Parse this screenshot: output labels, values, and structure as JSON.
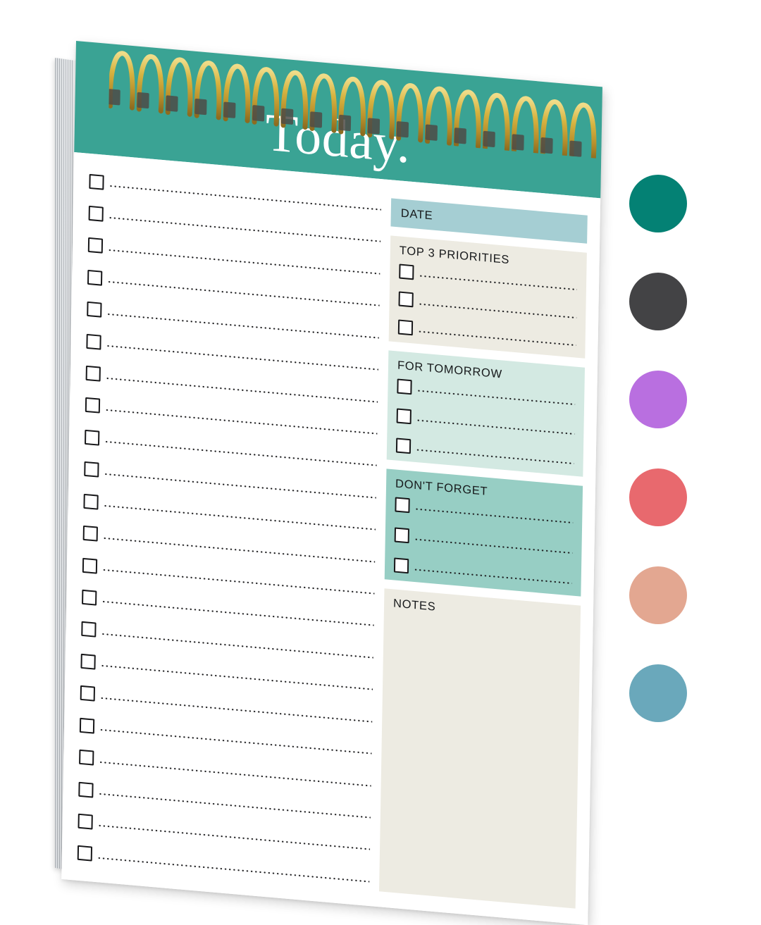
{
  "product": {
    "type": "spiral-bound daily to-do notepad",
    "header_title": "Today."
  },
  "notepad": {
    "header": {
      "title": "Today.",
      "background_color": "#3aa394",
      "title_color": "#ffffff"
    },
    "binding": {
      "style": "twin-loop wire spiral",
      "color": "#d4b23f",
      "loop_count": 17
    },
    "checklist": {
      "row_count": 22,
      "rows": [
        {
          "checkbox": "unchecked",
          "line": "dotted"
        },
        {
          "checkbox": "unchecked",
          "line": "dotted"
        },
        {
          "checkbox": "unchecked",
          "line": "dotted"
        },
        {
          "checkbox": "unchecked",
          "line": "dotted"
        },
        {
          "checkbox": "unchecked",
          "line": "dotted"
        },
        {
          "checkbox": "unchecked",
          "line": "dotted"
        },
        {
          "checkbox": "unchecked",
          "line": "dotted"
        },
        {
          "checkbox": "unchecked",
          "line": "dotted"
        },
        {
          "checkbox": "unchecked",
          "line": "dotted"
        },
        {
          "checkbox": "unchecked",
          "line": "dotted"
        },
        {
          "checkbox": "unchecked",
          "line": "dotted"
        },
        {
          "checkbox": "unchecked",
          "line": "dotted"
        },
        {
          "checkbox": "unchecked",
          "line": "dotted"
        },
        {
          "checkbox": "unchecked",
          "line": "dotted"
        },
        {
          "checkbox": "unchecked",
          "line": "dotted"
        },
        {
          "checkbox": "unchecked",
          "line": "dotted"
        },
        {
          "checkbox": "unchecked",
          "line": "dotted"
        },
        {
          "checkbox": "unchecked",
          "line": "dotted"
        },
        {
          "checkbox": "unchecked",
          "line": "dotted"
        },
        {
          "checkbox": "unchecked",
          "line": "dotted"
        },
        {
          "checkbox": "unchecked",
          "line": "dotted"
        },
        {
          "checkbox": "unchecked",
          "line": "dotted"
        }
      ]
    },
    "panels": [
      {
        "id": "date",
        "label": "DATE",
        "background_color": "#a5ced3",
        "rows": 0
      },
      {
        "id": "priorities",
        "label": "TOP 3 PRIORITIES",
        "background_color": "#edebe2",
        "rows": 3
      },
      {
        "id": "tomorrow",
        "label": "FOR TOMORROW",
        "background_color": "#d3e9e2",
        "rows": 3
      },
      {
        "id": "forget",
        "label": "DON'T FORGET",
        "background_color": "#97cec4",
        "rows": 3
      },
      {
        "id": "notes",
        "label": "NOTES",
        "background_color": "#edebe2",
        "rows": 0
      }
    ]
  },
  "swatches": [
    {
      "name": "teal",
      "color": "#048174"
    },
    {
      "name": "charcoal",
      "color": "#434345"
    },
    {
      "name": "orchid-purple",
      "color": "#b96fe0"
    },
    {
      "name": "coral-red",
      "color": "#e8696e"
    },
    {
      "name": "blush-peach",
      "color": "#e3a791"
    },
    {
      "name": "dusty-blue",
      "color": "#6aa8bb"
    }
  ]
}
